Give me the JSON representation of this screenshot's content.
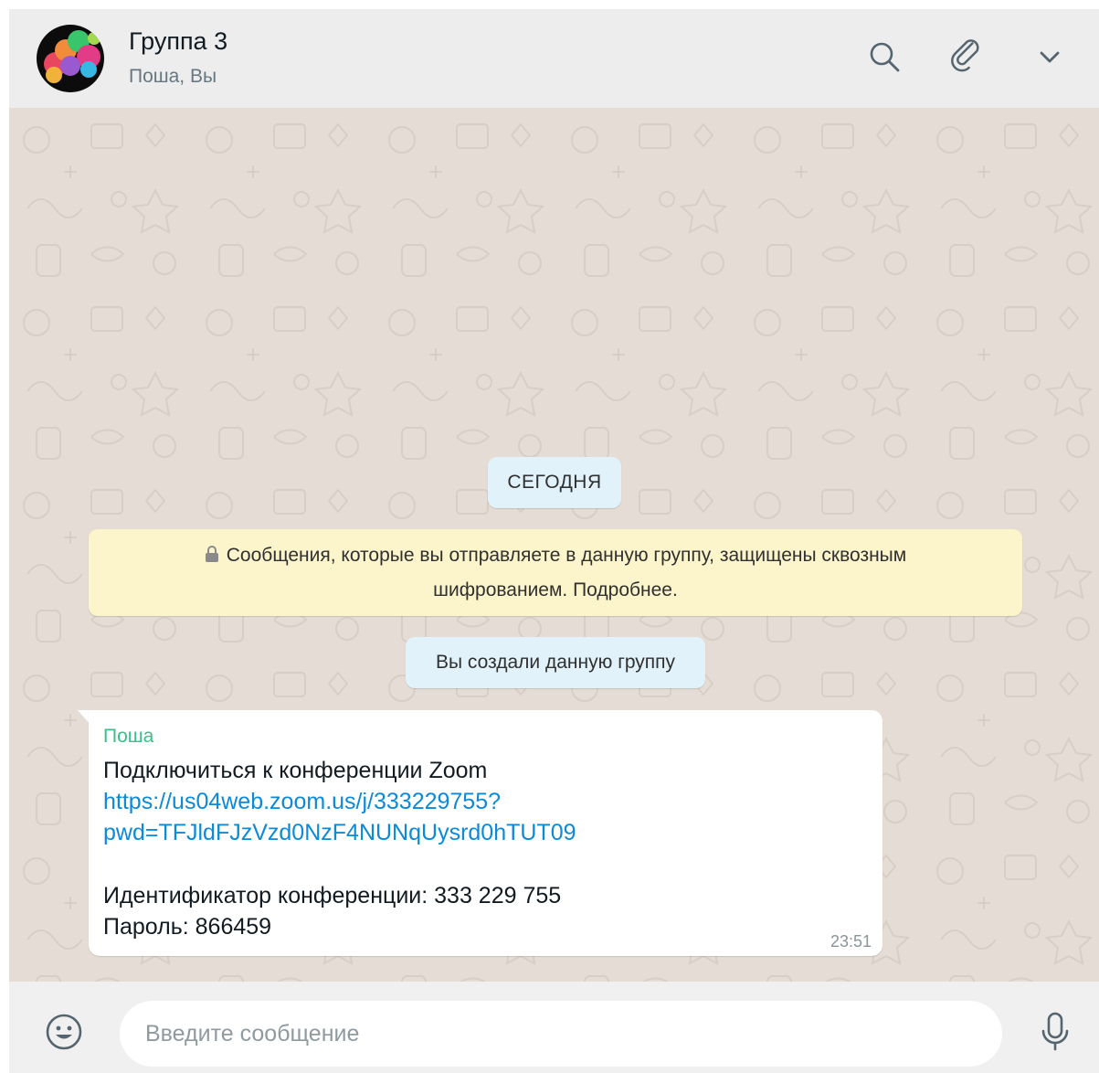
{
  "header": {
    "title": "Группа 3",
    "subtitle": "Поша, Вы",
    "icons": [
      "search-icon",
      "paperclip-icon",
      "chevron-down-icon"
    ]
  },
  "chat": {
    "date_label": "СЕГОДНЯ",
    "encryption_notice": {
      "line1": "Сообщения, которые вы отправляете в данную группу, защищены сквозным",
      "line2": "шифрованием. Подробнее."
    },
    "system_message": "Вы создали данную группу",
    "message": {
      "sender": "Поша",
      "line1": "Подключиться к конференции Zoom",
      "link_line1": "https://us04web.zoom.us/j/333229755?",
      "link_line2": "pwd=TFJldFJzVzd0NzF4NUNqUysrd0hTUT09",
      "conference_id": "Идентификатор конференции: 333 229 755",
      "password": "Пароль: 866459",
      "time": "23:51"
    }
  },
  "footer": {
    "input_placeholder": "Введите сообщение",
    "input_value": "",
    "icons": [
      "emoji-icon",
      "microphone-icon"
    ]
  },
  "colors": {
    "header_bg": "#ededed",
    "chat_bg": "#e5ddd5",
    "sender_name": "#35c28a",
    "link": "#0a8ad8",
    "system_pill": "#e1f2fb",
    "notice_bg": "#fcf4cb"
  }
}
